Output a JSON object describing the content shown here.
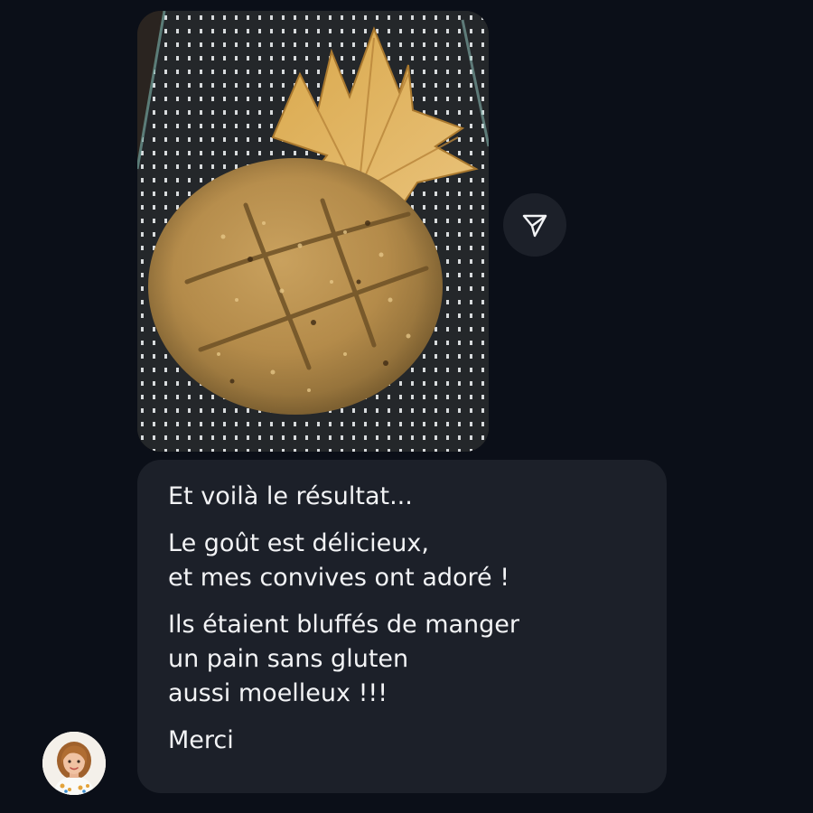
{
  "conversation": {
    "photo_message": {
      "image_subject": "gluten-free round bread loaf with a dried autumn leaf on a glass cooling board"
    },
    "share_button": {
      "icon": "paper-plane-icon"
    },
    "text_message": {
      "paragraphs": [
        "Et voilà le résultat...",
        "Le goût est délicieux,\net mes convives ont adoré !",
        "Ils étaient bluffés de manger\nun pain sans gluten\naussi moelleux !!!",
        "Merci"
      ]
    },
    "sender_avatar": {
      "icon": "avatar-icon"
    }
  },
  "colors": {
    "background": "#0b0f18",
    "bubble": "#1c2029",
    "text": "#f2f3f5"
  }
}
